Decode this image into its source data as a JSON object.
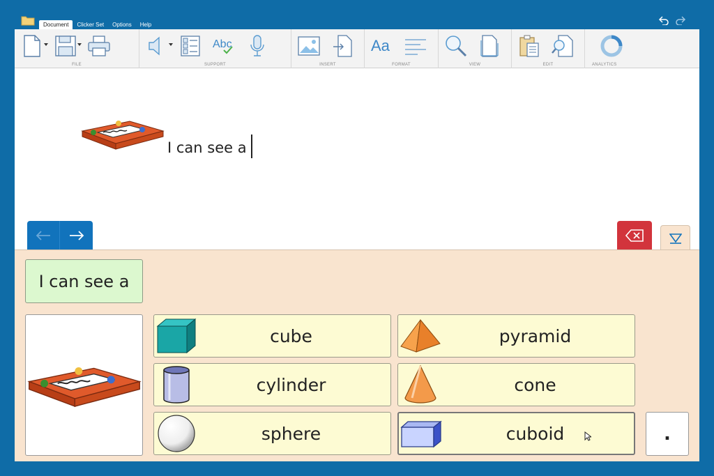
{
  "menu": {
    "tabs": [
      "Document",
      "Clicker Set",
      "Options",
      "Help"
    ]
  },
  "ribbon": {
    "groups": [
      {
        "label": "FILE",
        "icons": [
          "new-document-icon",
          "save-icon",
          "print-icon"
        ]
      },
      {
        "label": "SUPPORT",
        "icons": [
          "speaker-icon",
          "word-list-icon",
          "spell-check-icon",
          "microphone-icon"
        ]
      },
      {
        "label": "INSERT",
        "icons": [
          "insert-picture-icon",
          "insert-file-icon"
        ]
      },
      {
        "label": "FORMAT",
        "icons": [
          "font-icon",
          "paragraph-icon"
        ]
      },
      {
        "label": "VIEW",
        "icons": [
          "zoom-icon",
          "page-size-icon"
        ]
      },
      {
        "label": "EDIT",
        "icons": [
          "paste-icon",
          "find-icon"
        ]
      },
      {
        "label": "ANALYTICS",
        "icons": [
          "analytics-icon"
        ]
      }
    ],
    "spell_icon_text": "Abc",
    "font_icon_text": "Aa"
  },
  "document": {
    "text": "I can see a"
  },
  "panel": {
    "sentence": "I can see a",
    "words": [
      "cube",
      "pyramid",
      "cylinder",
      "cone",
      "sphere",
      "cuboid"
    ],
    "period": "."
  },
  "colors": {
    "frame": "#0f6ca7",
    "nav": "#1173bc",
    "delete": "#d2343c",
    "panel": "#f9e4cf",
    "sentence_cell": "#dcf8cf",
    "word_cell": "#fdfbd3"
  }
}
